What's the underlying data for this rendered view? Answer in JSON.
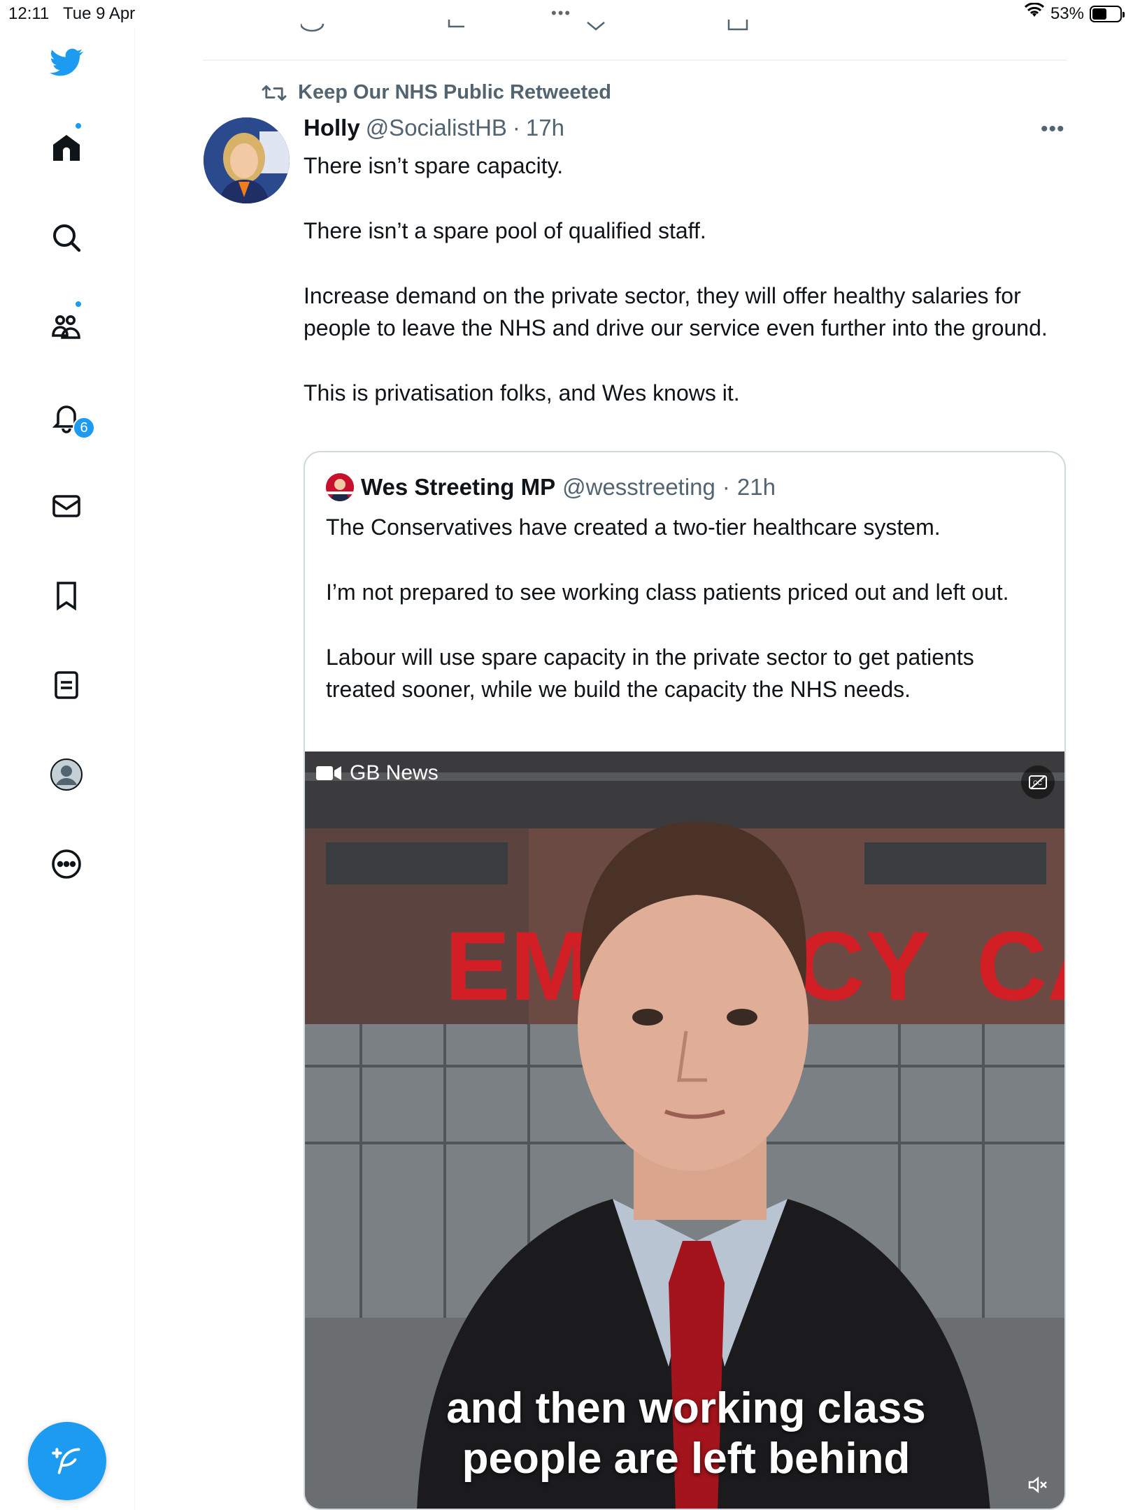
{
  "status_bar": {
    "time": "12:11",
    "date": "Tue 9 Apr",
    "battery": "53%",
    "battery_level": 0.53
  },
  "sidebar": {
    "items": [
      {
        "name": "home",
        "has_dot": true
      },
      {
        "name": "search"
      },
      {
        "name": "communities",
        "has_dot": true
      },
      {
        "name": "notifications",
        "badge": "6"
      },
      {
        "name": "messages"
      },
      {
        "name": "bookmarks"
      },
      {
        "name": "lists"
      },
      {
        "name": "profile"
      },
      {
        "name": "more"
      }
    ],
    "compose_label": "compose-tweet"
  },
  "tweet": {
    "retweeted_by": "Keep Our NHS Public Retweeted",
    "author_name": "Holly",
    "author_handle": "@SocialistHB",
    "separator": "·",
    "time": "17h",
    "more": "•••",
    "paragraphs": [
      "There isn’t spare capacity.",
      "There isn’t a spare pool of qualified staff.",
      "Increase demand on the private sector, they will offer healthy salaries for people to leave the NHS and drive our service even further into the ground.",
      "This is privatisation folks, and Wes knows it."
    ]
  },
  "quote": {
    "author_name": "Wes Streeting MP",
    "author_handle": "@wesstreeting",
    "separator": "·",
    "time": "21h",
    "paragraphs": [
      "The Conservatives have created a two-tier healthcare system.",
      "I’m not prepared to see working class patients priced out and left out.",
      "Labour will use spare capacity in the private sector to get patients treated sooner, while we build the capacity the NHS needs."
    ],
    "video": {
      "source_label": "GB News",
      "sign_left": "EME",
      "sign_middle": "CY",
      "sign_right": "CA",
      "caption_line1": "and then working class",
      "caption_line2": "people are left behind"
    }
  },
  "colors": {
    "accent": "#1d9bf0",
    "text": "#0f1419",
    "muted": "#536471",
    "border": "#cfd9de"
  }
}
